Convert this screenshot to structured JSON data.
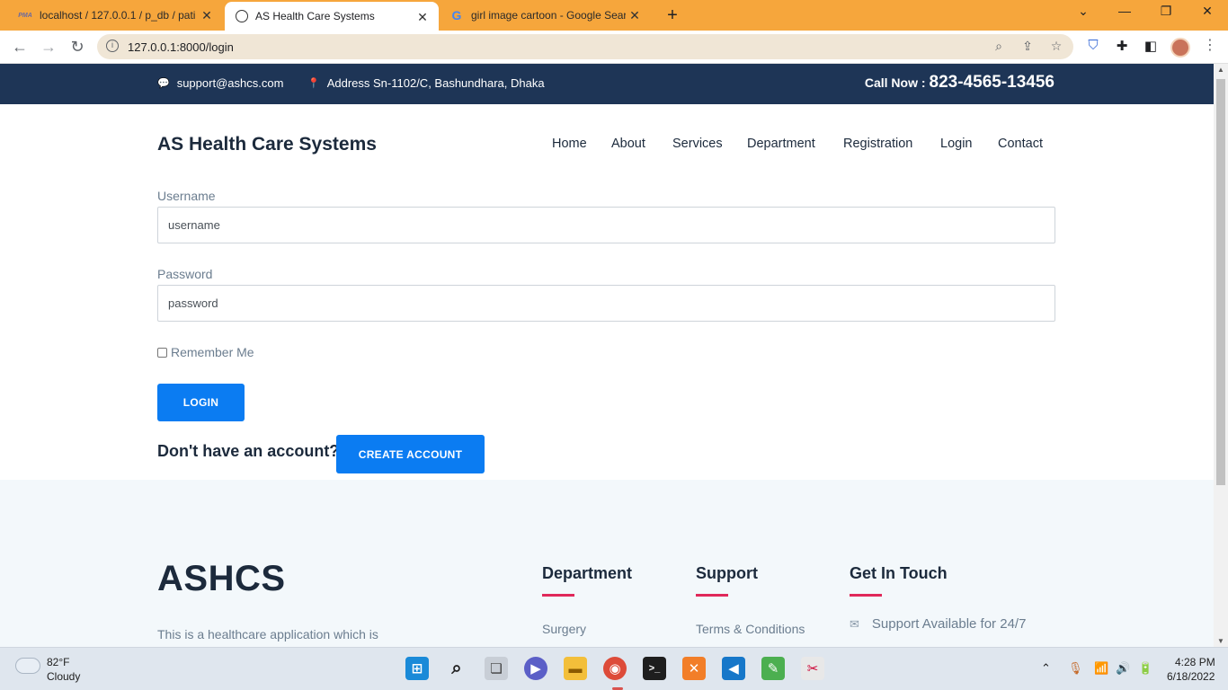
{
  "browser": {
    "tabs": [
      {
        "title": "localhost / 127.0.0.1 / p_db / pati",
        "favicon": "phpmyadmin-icon"
      },
      {
        "title": "AS Health Care Systems",
        "favicon": "globe-icon"
      },
      {
        "title": "girl image cartoon - Google Sear",
        "favicon": "google-icon"
      }
    ],
    "close_glyph": "✕",
    "new_tab_glyph": "+",
    "url": "127.0.0.1:8000/login"
  },
  "topbar": {
    "email": "support@ashcs.com",
    "address": "Address Sn-1102/C, Bashundhara, Dhaka",
    "call_label": "Call Now :",
    "phone": "823-4565-13456"
  },
  "header": {
    "brand": "AS Health Care Systems",
    "nav": [
      "Home",
      "About",
      "Services",
      "Department",
      "Registration",
      "Login",
      "Contact"
    ]
  },
  "form": {
    "username_label": "Username",
    "username_placeholder": "username",
    "password_label": "Password",
    "password_placeholder": "password",
    "remember_label": "Remember Me",
    "login_button": "LOGIN",
    "no_account_text": "Don't have an account?",
    "create_button": "CREATE ACCOUNT"
  },
  "footer": {
    "brand": "ASHCS",
    "description": "This is a healthcare application which is",
    "columns": [
      {
        "heading": "Department",
        "link": "Surgery"
      },
      {
        "heading": "Support",
        "link": "Terms & Conditions"
      },
      {
        "heading": "Get In Touch",
        "link": "Support Available for 24/7"
      }
    ]
  },
  "taskbar": {
    "weather_temp": "82°F",
    "weather_desc": "Cloudy",
    "time": "4:28 PM",
    "date": "6/18/2022"
  },
  "colors": {
    "tabbar": "#f6a63c",
    "topbar": "#1e3556",
    "button": "#0b7cf2",
    "footer_accent": "#e0285a"
  }
}
